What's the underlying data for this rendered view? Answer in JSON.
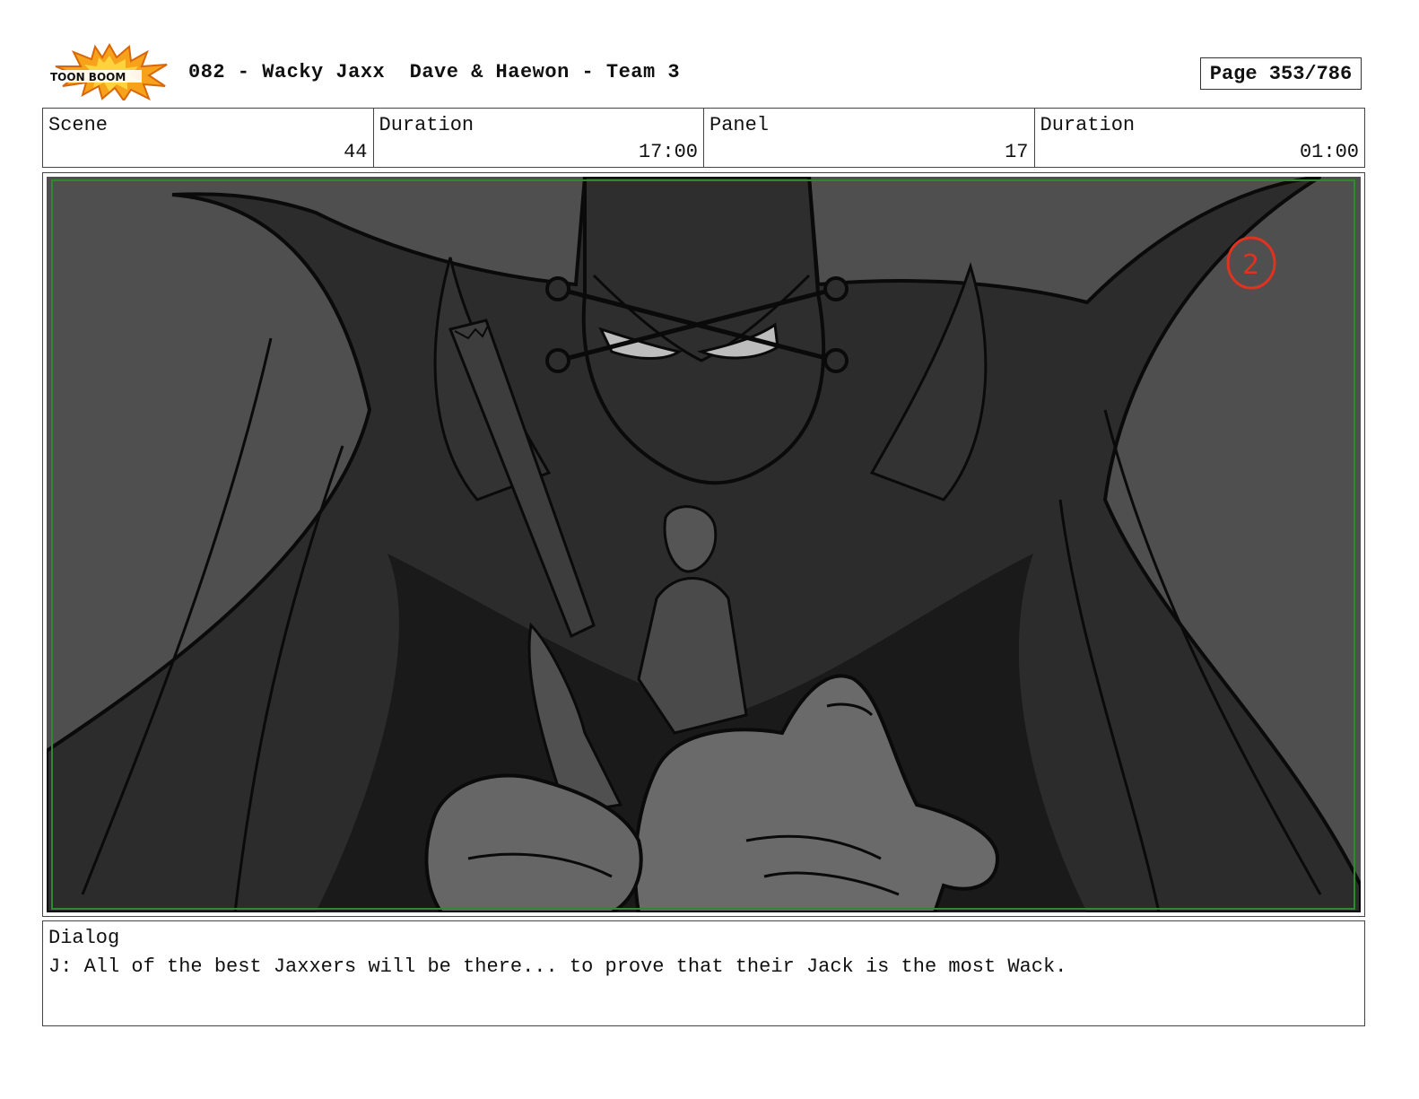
{
  "header": {
    "logo_text": "TOON BOOM",
    "title": "082 - Wacky Jaxx  Dave & Haewon - Team 3",
    "page_label": "Page 353/786"
  },
  "info": {
    "scene_label": "Scene",
    "scene_value": "44",
    "scene_duration_label": "Duration",
    "scene_duration_value": "17:00",
    "panel_label": "Panel",
    "panel_value": "17",
    "panel_duration_label": "Duration",
    "panel_duration_value": "01:00"
  },
  "panel": {
    "annotation_mark": "2",
    "annotation_color": "#e0321e",
    "safe_frame_color": "#2d8a2d"
  },
  "dialog": {
    "label": "Dialog",
    "text": "J: All of the best Jaxxers will be there... to prove that their Jack is the most Wack."
  }
}
